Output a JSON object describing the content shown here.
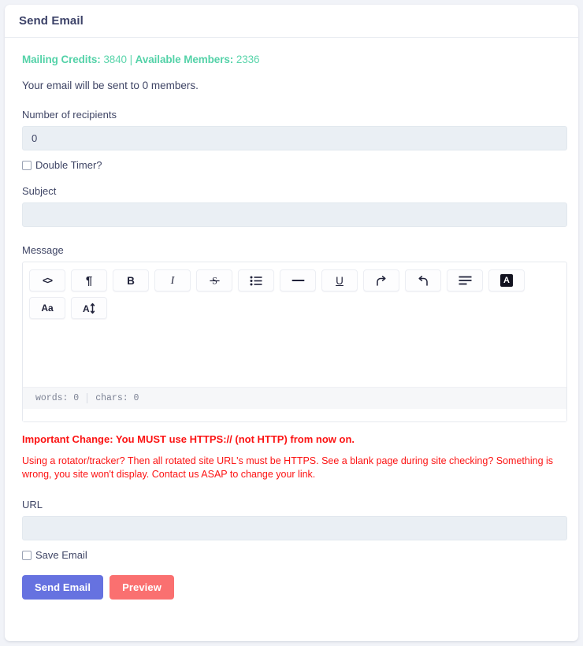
{
  "header": {
    "title": "Send Email"
  },
  "credits": {
    "mailing_label": "Mailing Credits:",
    "mailing_value": " 3840 | ",
    "members_label": "Available Members:",
    "members_value": " 2336"
  },
  "sent_note": "Your email will be sent to 0 members.",
  "recipients": {
    "label": "Number of recipients",
    "value": "0"
  },
  "double_timer": {
    "label": "Double Timer?"
  },
  "subject": {
    "label": "Subject",
    "value": ""
  },
  "message": {
    "label": "Message",
    "toolbar": [
      {
        "name": "code-icon",
        "glyph": "<>"
      },
      {
        "name": "pilcrow-icon",
        "glyph": "¶"
      },
      {
        "name": "bold-icon",
        "glyph": "B"
      },
      {
        "name": "italic-icon",
        "glyph": "I"
      },
      {
        "name": "strikethrough-icon",
        "glyph": "S"
      },
      {
        "name": "bullet-list-icon",
        "glyph": ""
      },
      {
        "name": "horizontal-rule-icon",
        "glyph": ""
      },
      {
        "name": "underline-icon",
        "glyph": "U"
      },
      {
        "name": "redo-icon",
        "glyph": ""
      },
      {
        "name": "undo-icon",
        "glyph": ""
      },
      {
        "name": "align-icon",
        "glyph": ""
      },
      {
        "name": "highlight-icon",
        "glyph": "A"
      },
      {
        "name": "font-family-icon",
        "glyph": "Aa"
      },
      {
        "name": "font-size-icon",
        "glyph": "A"
      }
    ],
    "status": {
      "words": "words: 0",
      "chars": "chars: 0"
    },
    "body": ""
  },
  "warning": {
    "headline": "Important Change: You MUST use HTTPS:// (not HTTP) from now on.",
    "body": "Using a rotator/tracker? Then all rotated site URL's must be HTTPS. See a blank page during site checking? Something is wrong, you site won't display. Contact us ASAP to change your link."
  },
  "url": {
    "label": "URL",
    "value": ""
  },
  "save_email": {
    "label": "Save Email"
  },
  "actions": {
    "send_label": "Send Email",
    "preview_label": "Preview"
  },
  "colors": {
    "accent_green": "#54d2a8",
    "warning_red": "#fc1313",
    "send_button": "#6672e0",
    "preview_button": "#fa7070",
    "text": "#3f4565"
  }
}
